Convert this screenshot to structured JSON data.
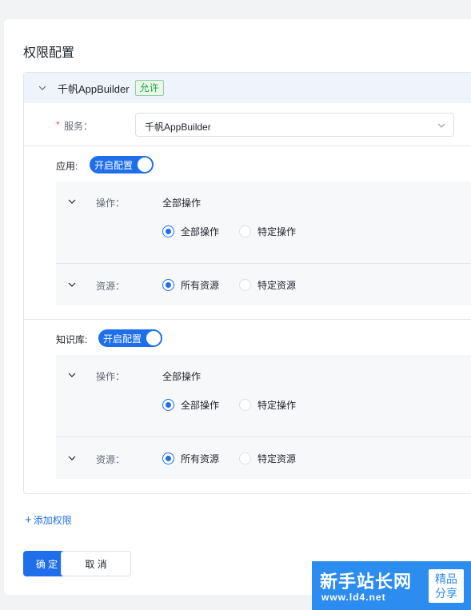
{
  "page_title": "权限配置",
  "permission": {
    "header_name": "千帆AppBuilder",
    "tag": "允许",
    "service": {
      "label": "服务：",
      "value": "千帆AppBuilder"
    },
    "sections": [
      {
        "label": "应用:",
        "switch_label": "开启配置",
        "operation": {
          "label": "操作：",
          "value": "全部操作",
          "options": [
            "全部操作",
            "特定操作"
          ],
          "selected": "全部操作"
        },
        "resource": {
          "label": "资源：",
          "options": [
            "所有资源",
            "特定资源"
          ],
          "selected": "所有资源"
        }
      },
      {
        "label": "知识库:",
        "switch_label": "开启配置",
        "operation": {
          "label": "操作：",
          "value": "全部操作",
          "options": [
            "全部操作",
            "特定操作"
          ],
          "selected": "全部操作"
        },
        "resource": {
          "label": "资源：",
          "options": [
            "所有资源",
            "特定资源"
          ],
          "selected": "所有资源"
        }
      }
    ]
  },
  "add_permission": "添加权限",
  "buttons": {
    "confirm": "确 定",
    "cancel": "取 消"
  },
  "watermark": {
    "title": "新手站长网",
    "url": "www.ld4.net",
    "badge_line1": "精品",
    "badge_line2": "分享"
  },
  "colors": {
    "primary": "#1f6feb",
    "allow_tag": "#23a23b",
    "required": "#f54a45"
  },
  "icons": {
    "expand": "chevron-down-icon",
    "add": "plus-icon"
  }
}
